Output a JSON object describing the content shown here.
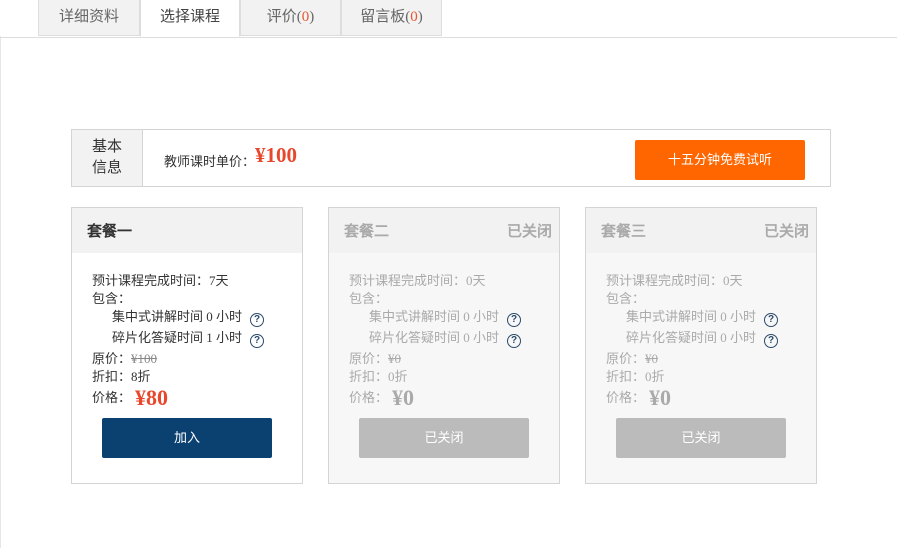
{
  "tabs": [
    {
      "label": "详细资料"
    },
    {
      "label": "选择课程"
    },
    {
      "label": "评价",
      "count": "0"
    },
    {
      "label": "留言板",
      "count": "0"
    }
  ],
  "basic_info": {
    "label": "基本信息",
    "price_label": "教师课时单价：",
    "price": "¥100",
    "trial_button": "十五分钟免费试听"
  },
  "packages": [
    {
      "name": "套餐一",
      "status": "",
      "duration_label": "预计课程完成时间：",
      "duration": "7天",
      "includes_label": "包含：",
      "lecture": "集中式讲解时间 0 小时",
      "qa": "碎片化答疑时间 1 小时",
      "orig_label": "原价：",
      "orig_price": "¥100",
      "discount_label": "折扣：",
      "discount": "8折",
      "price_label": "价格：",
      "price": "¥80",
      "button": "加入"
    },
    {
      "name": "套餐二",
      "status": "已关闭",
      "duration_label": "预计课程完成时间：",
      "duration": "0天",
      "includes_label": "包含：",
      "lecture": "集中式讲解时间 0 小时",
      "qa": "碎片化答疑时间 0 小时",
      "orig_label": "原价：",
      "orig_price": "¥0",
      "discount_label": "折扣：",
      "discount": "0折",
      "price_label": "价格：",
      "price": "¥0",
      "button": "已关闭"
    },
    {
      "name": "套餐三",
      "status": "已关闭",
      "duration_label": "预计课程完成时间：",
      "duration": "0天",
      "includes_label": "包含：",
      "lecture": "集中式讲解时间 0 小时",
      "qa": "碎片化答疑时间 0 小时",
      "orig_label": "原价：",
      "orig_price": "¥0",
      "discount_label": "折扣：",
      "discount": "0折",
      "price_label": "价格：",
      "price": "¥0",
      "button": "已关闭"
    }
  ],
  "icons": {
    "help": "question-circle-icon",
    "help_glyph": "?"
  },
  "colors": {
    "accent_orange": "#ff6600",
    "price_red": "#e8472c",
    "join_blue": "#0b4171",
    "disabled_gray": "#bbbbbb"
  }
}
